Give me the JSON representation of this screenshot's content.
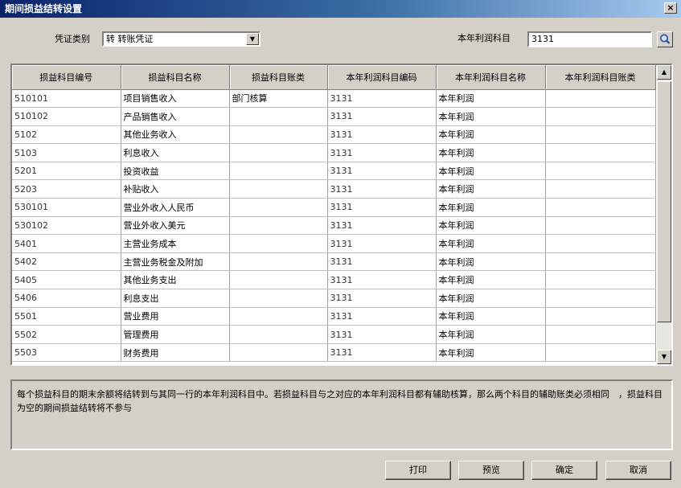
{
  "window": {
    "title": "期间损益结转设置",
    "close_glyph": "×"
  },
  "voucher_type": {
    "label": "凭证类别",
    "value": "转 转账凭证"
  },
  "profit_account": {
    "label": "本年利润科目",
    "value": "3131"
  },
  "table": {
    "headers": [
      "损益科目编号",
      "损益科目名称",
      "损益科目账类",
      "本年利润科目编码",
      "本年利润科目名称",
      "本年利润科目账类"
    ],
    "rows": [
      [
        "510101",
        "项目销售收入",
        "部门核算",
        "3131",
        "本年利润",
        ""
      ],
      [
        "510102",
        "产品销售收入",
        "",
        "3131",
        "本年利润",
        ""
      ],
      [
        "5102",
        "其他业务收入",
        "",
        "3131",
        "本年利润",
        ""
      ],
      [
        "5103",
        "利息收入",
        "",
        "3131",
        "本年利润",
        ""
      ],
      [
        "5201",
        "投资收益",
        "",
        "3131",
        "本年利润",
        ""
      ],
      [
        "5203",
        "补贴收入",
        "",
        "3131",
        "本年利润",
        ""
      ],
      [
        "530101",
        "营业外收入人民币",
        "",
        "3131",
        "本年利润",
        ""
      ],
      [
        "530102",
        "营业外收入美元",
        "",
        "3131",
        "本年利润",
        ""
      ],
      [
        "5401",
        "主营业务成本",
        "",
        "3131",
        "本年利润",
        ""
      ],
      [
        "5402",
        "主营业务税金及附加",
        "",
        "3131",
        "本年利润",
        ""
      ],
      [
        "5405",
        "其他业务支出",
        "",
        "3131",
        "本年利润",
        ""
      ],
      [
        "5406",
        "利息支出",
        "",
        "3131",
        "本年利润",
        ""
      ],
      [
        "5501",
        "营业费用",
        "",
        "3131",
        "本年利润",
        ""
      ],
      [
        "5502",
        "管理费用",
        "",
        "3131",
        "本年利润",
        ""
      ],
      [
        "5503",
        "财务费用",
        "",
        "3131",
        "本年利润",
        ""
      ]
    ]
  },
  "note": "每个损益科目的期末余额将结转到与其同一行的本年利润科目中。若损益科目与之对应的本年利润科目都有辅助核算，那么两个科目的辅助账类必须相同　，损益科目为空的期间损益结转将不参与",
  "buttons": {
    "print": "打印",
    "preview": "预览",
    "ok": "确定",
    "cancel": "取消"
  }
}
